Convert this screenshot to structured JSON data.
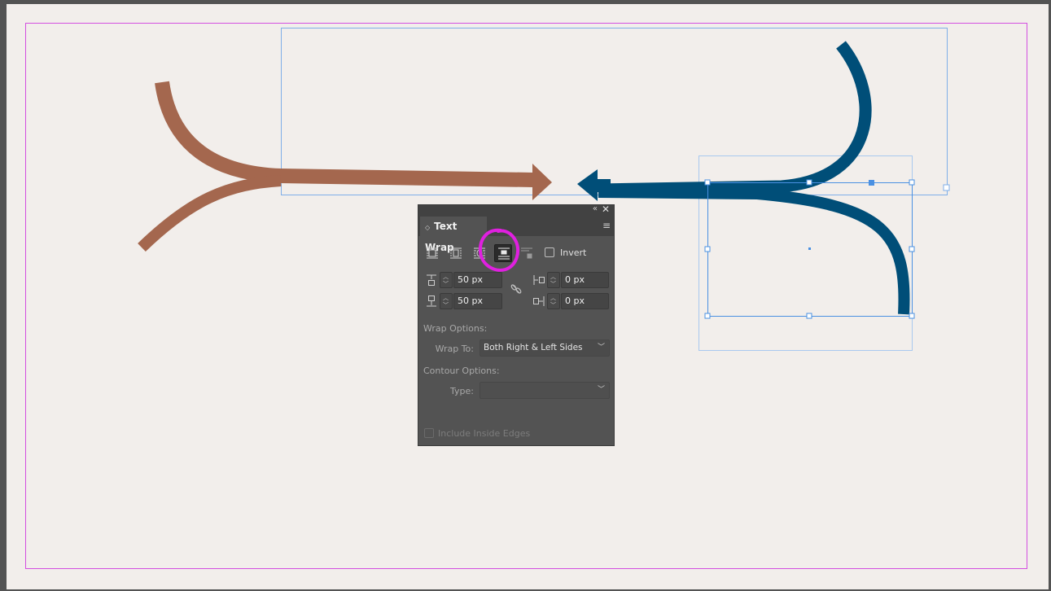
{
  "panel": {
    "title": "Text Wrap",
    "collapse_glyph": "«",
    "close_glyph": "✕",
    "menu_glyph": "≡",
    "tab_arrows_glyph": "◇",
    "wrap_buttons": [
      {
        "name": "no-wrap-icon"
      },
      {
        "name": "wrap-around-bounding-box-icon"
      },
      {
        "name": "wrap-around-object-shape-icon"
      },
      {
        "name": "jump-object-icon",
        "active": true
      },
      {
        "name": "jump-to-next-column-icon"
      }
    ],
    "invert_label": "Invert",
    "offsets": {
      "top": "50 px",
      "bottom": "50 px",
      "left": "0 px",
      "right": "0 px"
    },
    "wrap_options_label": "Wrap Options:",
    "wrap_to_label": "Wrap To:",
    "wrap_to_value": "Both Right & Left Sides",
    "contour_options_label": "Contour Options:",
    "type_label": "Type:",
    "type_value": "",
    "include_inside_edges_label": "Include Inside Edges"
  },
  "colors": {
    "page_background": "#f2eeeb",
    "margin_guide": "#d34ee0",
    "frame_selection": "#4a90e2",
    "brown_arrow": "#a4674e",
    "blue_arrow": "#004e78",
    "highlight_circle": "#e020e0"
  }
}
